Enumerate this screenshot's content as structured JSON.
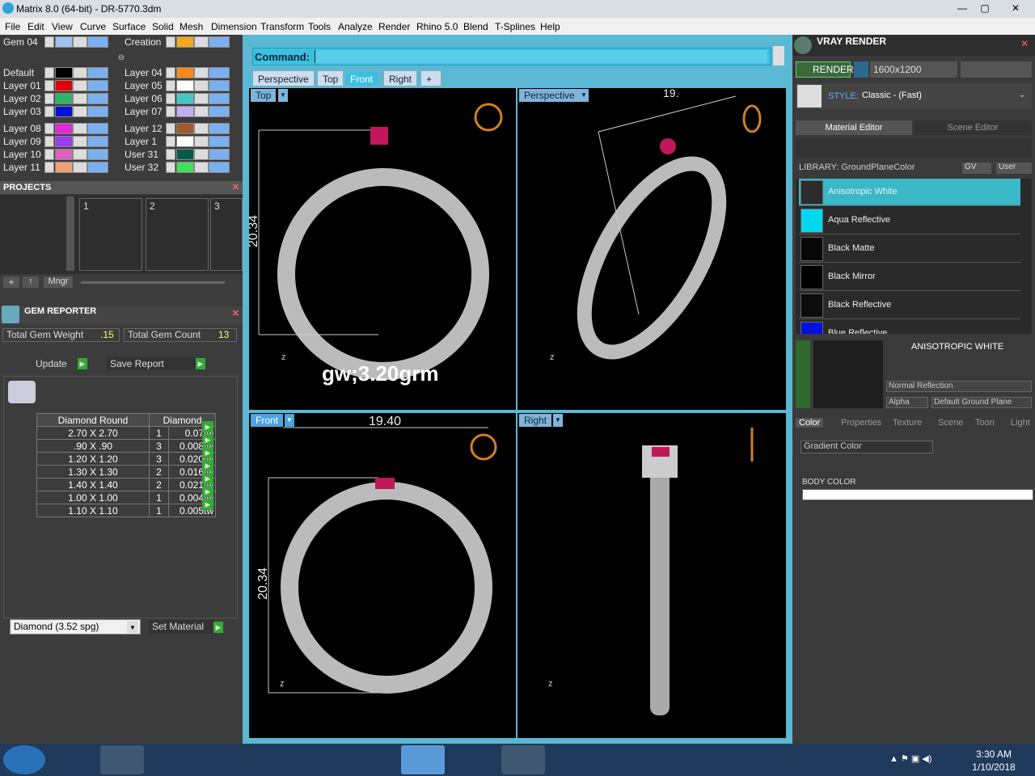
{
  "window": {
    "title": "Matrix 8.0 (64-bit) - DR-5770.3dm",
    "minimize": "—",
    "maximize": "▢",
    "close": "✕"
  },
  "menu": [
    "File",
    "Edit",
    "View",
    "Curve",
    "Surface",
    "Solid",
    "Mesh",
    "Dimension",
    "Transform",
    "Tools",
    "Analyze",
    "Render",
    "Rhino 5.0",
    "Blend",
    "T-Splines",
    "Help"
  ],
  "layers": {
    "top": [
      {
        "name": "Gem 04",
        "color": "#9dc3f0"
      },
      {
        "name": "Creation",
        "color": "#f5a623"
      }
    ],
    "col1": [
      {
        "name": "Default",
        "color": "#000000"
      },
      {
        "name": "Layer 01",
        "color": "#e00000"
      },
      {
        "name": "Layer 02",
        "color": "#2db56a"
      },
      {
        "name": "Layer 03",
        "color": "#0010d8"
      },
      {
        "name": "Layer 08",
        "color": "#e02bd6"
      },
      {
        "name": "Layer 09",
        "color": "#9a3cf0"
      },
      {
        "name": "Layer 10",
        "color": "#e060c0"
      },
      {
        "name": "Layer 11",
        "color": "#f0a070"
      }
    ],
    "col2": [
      {
        "name": "Layer 04",
        "color": "#f58a20"
      },
      {
        "name": "Layer 05",
        "color": "#ffffff"
      },
      {
        "name": "Layer 06",
        "color": "#40c8c8"
      },
      {
        "name": "Layer 07",
        "color": "#c0b0f0"
      },
      {
        "name": "Layer 12",
        "color": "#a0582c"
      },
      {
        "name": "Layer 1",
        "color": "#ffffff"
      },
      {
        "name": "User 31",
        "color": "#0a5a4a"
      },
      {
        "name": "User 32",
        "color": "#40e060"
      }
    ]
  },
  "projects": {
    "title": "PROJECTS",
    "slots": [
      "1",
      "2",
      "3"
    ],
    "mngr": "Mngr",
    "add": "+"
  },
  "gem_reporter": {
    "title": "GEM REPORTER",
    "total_weight_label": "Total Gem Weight",
    "total_weight": ".15",
    "total_count_label": "Total Gem Count",
    "total_count": "13",
    "update": "Update",
    "save_report": "Save Report",
    "col_shape": "Diamond Round",
    "col_type": "Diamond",
    "rows": [
      {
        "size": "2.70 X 2.70",
        "count": "1",
        "tw": "0.07tw"
      },
      {
        "size": ".90 X .90",
        "count": "3",
        "tw": "0.008tw"
      },
      {
        "size": "1.20 X 1.20",
        "count": "3",
        "tw": "0.020tw"
      },
      {
        "size": "1.30 X 1.30",
        "count": "2",
        "tw": "0.016tw"
      },
      {
        "size": "1.40 X 1.40",
        "count": "2",
        "tw": "0.021tw"
      },
      {
        "size": "1.00 X 1.00",
        "count": "1",
        "tw": "0.004tw"
      },
      {
        "size": "1.10 X 1.10",
        "count": "1",
        "tw": "0.005tw"
      }
    ],
    "material_select": "Diamond     (3.52 spg)",
    "set_material": "Set Material"
  },
  "command": {
    "label": "Command:",
    "value": ""
  },
  "view_tabs": [
    "Perspective",
    "Top",
    "Front",
    "Right",
    "+"
  ],
  "viewports": {
    "top": {
      "label": "Top",
      "dim_v": "20.34",
      "note": "gw;3.20grm"
    },
    "perspective": {
      "label": "Perspective",
      "dim_top": "19."
    },
    "front": {
      "label": "Front",
      "dim_h": "19.40",
      "dim_v": "20.34"
    },
    "right": {
      "label": "Right"
    }
  },
  "vray": {
    "title": "VRAY RENDER",
    "render": "RENDER",
    "resolution": "1600x1200",
    "style_label": "STYLE:",
    "style_value": "Classic - (Fast)",
    "tab_material": "Material Editor",
    "tab_scene": "Scene Editor",
    "library": "LIBRARY: GroundPlaneColor",
    "gv": "GV",
    "user": "User",
    "materials": [
      {
        "name": "Anisotropic White",
        "color": "#2c2c2c",
        "selected": true
      },
      {
        "name": "Aqua Reflective",
        "color": "#00d8f0"
      },
      {
        "name": "Black Matte",
        "color": "#080808"
      },
      {
        "name": "Black Mirror",
        "color": "#000000"
      },
      {
        "name": "Black Reflective",
        "color": "#0c0c0c"
      },
      {
        "name": "Blue Reflective",
        "color": "#0010e0"
      }
    ],
    "preview_title": "ANISOTROPIC WHITE",
    "reflection": "Normal Reflection",
    "alpha": "Alpha",
    "ground": "Default Ground Plane",
    "prop_tabs": [
      "Color",
      "Properties",
      "Texture",
      "Scene",
      "Toon",
      "Light"
    ],
    "gradient": "Gradient Color",
    "body_color": "BODY COLOR"
  },
  "taskbar": {
    "time": "3:30 AM",
    "date": "1/10/2018"
  }
}
